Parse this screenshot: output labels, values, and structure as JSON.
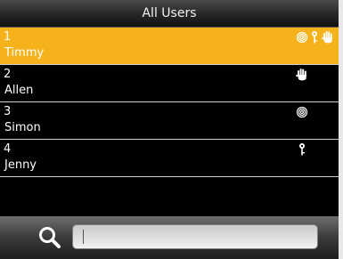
{
  "header": {
    "title": "All Users"
  },
  "users": [
    {
      "id": "1",
      "name": "Timmy",
      "selected": true,
      "icons": [
        "fingerprint-icon",
        "password-key-icon",
        "palm-icon"
      ]
    },
    {
      "id": "2",
      "name": "Allen",
      "selected": false,
      "icons": [
        "palm-icon"
      ]
    },
    {
      "id": "3",
      "name": "Simon",
      "selected": false,
      "icons": [
        "fingerprint-icon"
      ]
    },
    {
      "id": "4",
      "name": "Jenny",
      "selected": false,
      "icons": [
        "password-key-icon"
      ]
    }
  ],
  "search": {
    "value": "",
    "placeholder": ""
  },
  "colors": {
    "selected_row": "#f6b21b",
    "background": "#000000",
    "row_text": "#ffffff"
  }
}
